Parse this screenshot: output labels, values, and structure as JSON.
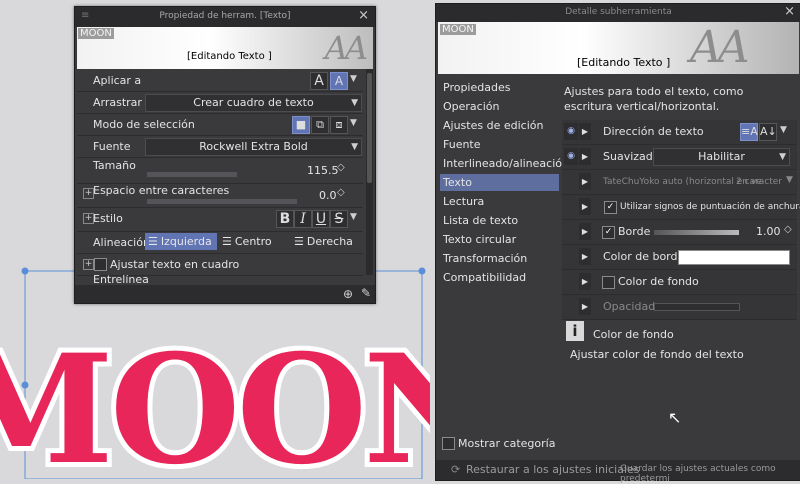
{
  "canvas": {
    "text": "MOON",
    "text_color": "#e8265a",
    "border_color": "#ffffff"
  },
  "tool_panel": {
    "title": "Propiedad de herram. [Texto]",
    "preview_tag": "MOON",
    "preview_label": "[Editando Texto ]",
    "preview_glyphs": "AA",
    "rows": {
      "apply_to": "Aplicar a",
      "drag": "Arrastrar",
      "drag_value": "Crear cuadro de texto",
      "selection_mode": "Modo de selección",
      "font": "Fuente",
      "font_value": "Rockwell Extra Bold",
      "size": "Tamaño",
      "size_value": "115.5",
      "spacing": "Espacio entre caracteres",
      "spacing_value": "0.0",
      "style": "Estilo",
      "alignment": "Alineación",
      "align_left": "Izquierda",
      "align_center": "Centro",
      "align_right": "Derecha",
      "fit_text": "Ajustar texto en cuadro",
      "line_spacing": "Entrelínea"
    }
  },
  "detail_panel": {
    "title": "Detalle subherramienta",
    "preview_tag": "MOON",
    "preview_label": "[Editando Texto ]",
    "preview_glyphs": "AA",
    "categories": [
      "Propiedades",
      "Operación",
      "Ajustes de edición",
      "Fuente",
      "Interlineado/alineación",
      "Texto",
      "Lectura",
      "Lista de texto",
      "Texto circular",
      "Transformación",
      "Compatibilidad"
    ],
    "selected_category": "Texto",
    "description": "Ajustes para todo el texto, como escritura vertical/horizontal.",
    "settings": {
      "direction": "Dirección de texto",
      "smoothing": "Suavizado",
      "smoothing_value": "Habilitar",
      "tatechuyoko": "TateChuYoko auto (horizontal en ve",
      "tatechuyoko_value": "2 caracter",
      "punct": "Utilizar signos de puntuación de anchura media",
      "border": "Borde",
      "border_value": "1.00",
      "border_color": "Color de borde",
      "bg_color": "Color de fondo",
      "opacity": "Opacidad"
    },
    "help_title": "Color de fondo",
    "help_text": "Ajustar color de fondo del texto",
    "show_category": "Mostrar categoría",
    "restore": "Restaurar a los ajustes iniciales",
    "save_default": "Guardar los ajustes actuales como predetermi"
  }
}
